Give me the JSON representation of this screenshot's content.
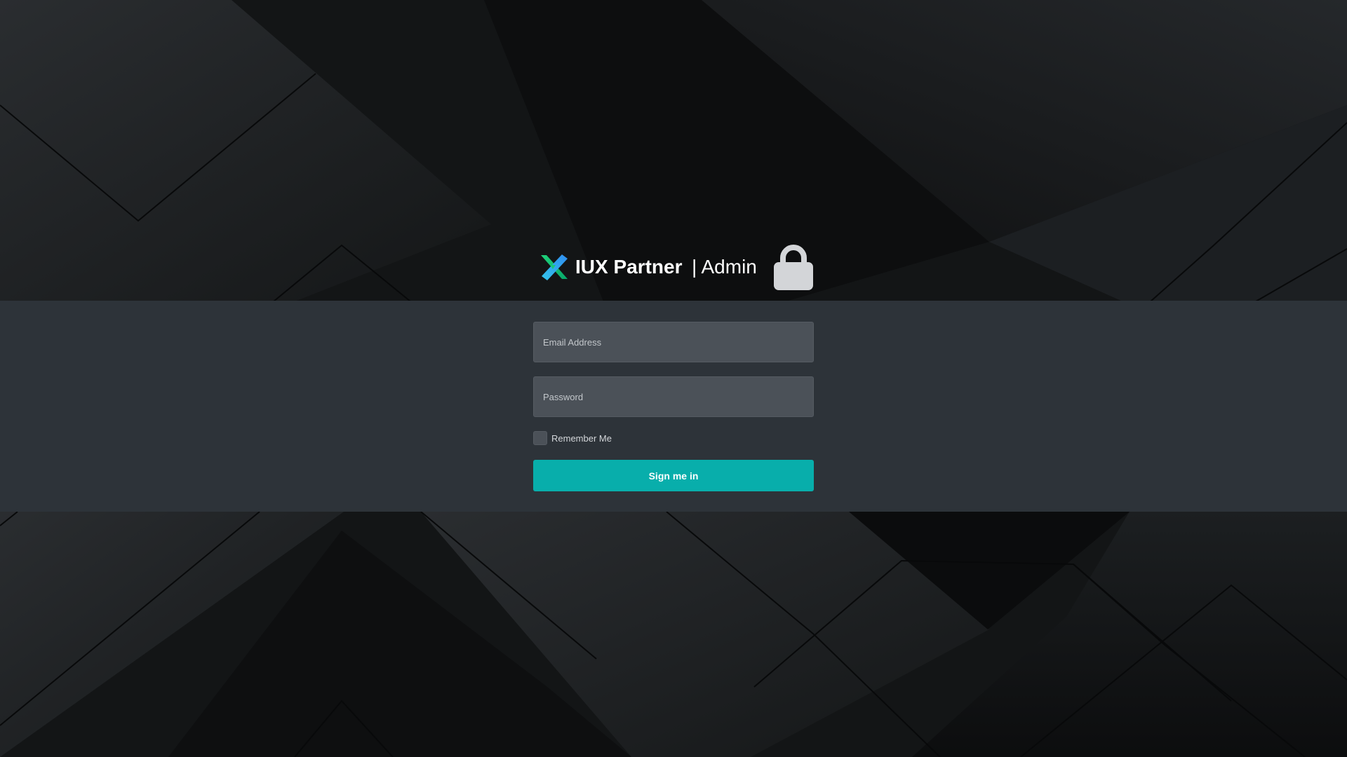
{
  "header": {
    "brand_name": "IUX Partner",
    "suffix": "| Admin",
    "logo_icon": "iux-x-logo-icon",
    "lock_icon": "padlock-icon"
  },
  "form": {
    "email_placeholder": "Email Address",
    "email_value": "",
    "password_placeholder": "Password",
    "password_value": "",
    "remember_label": "Remember Me",
    "remember_checked": false,
    "submit_label": "Sign me in"
  },
  "colors": {
    "background": "#121415",
    "band": "#2d3339",
    "field": "#4b5158",
    "accent": "#08aeab",
    "lock": "#d3d5d8"
  }
}
